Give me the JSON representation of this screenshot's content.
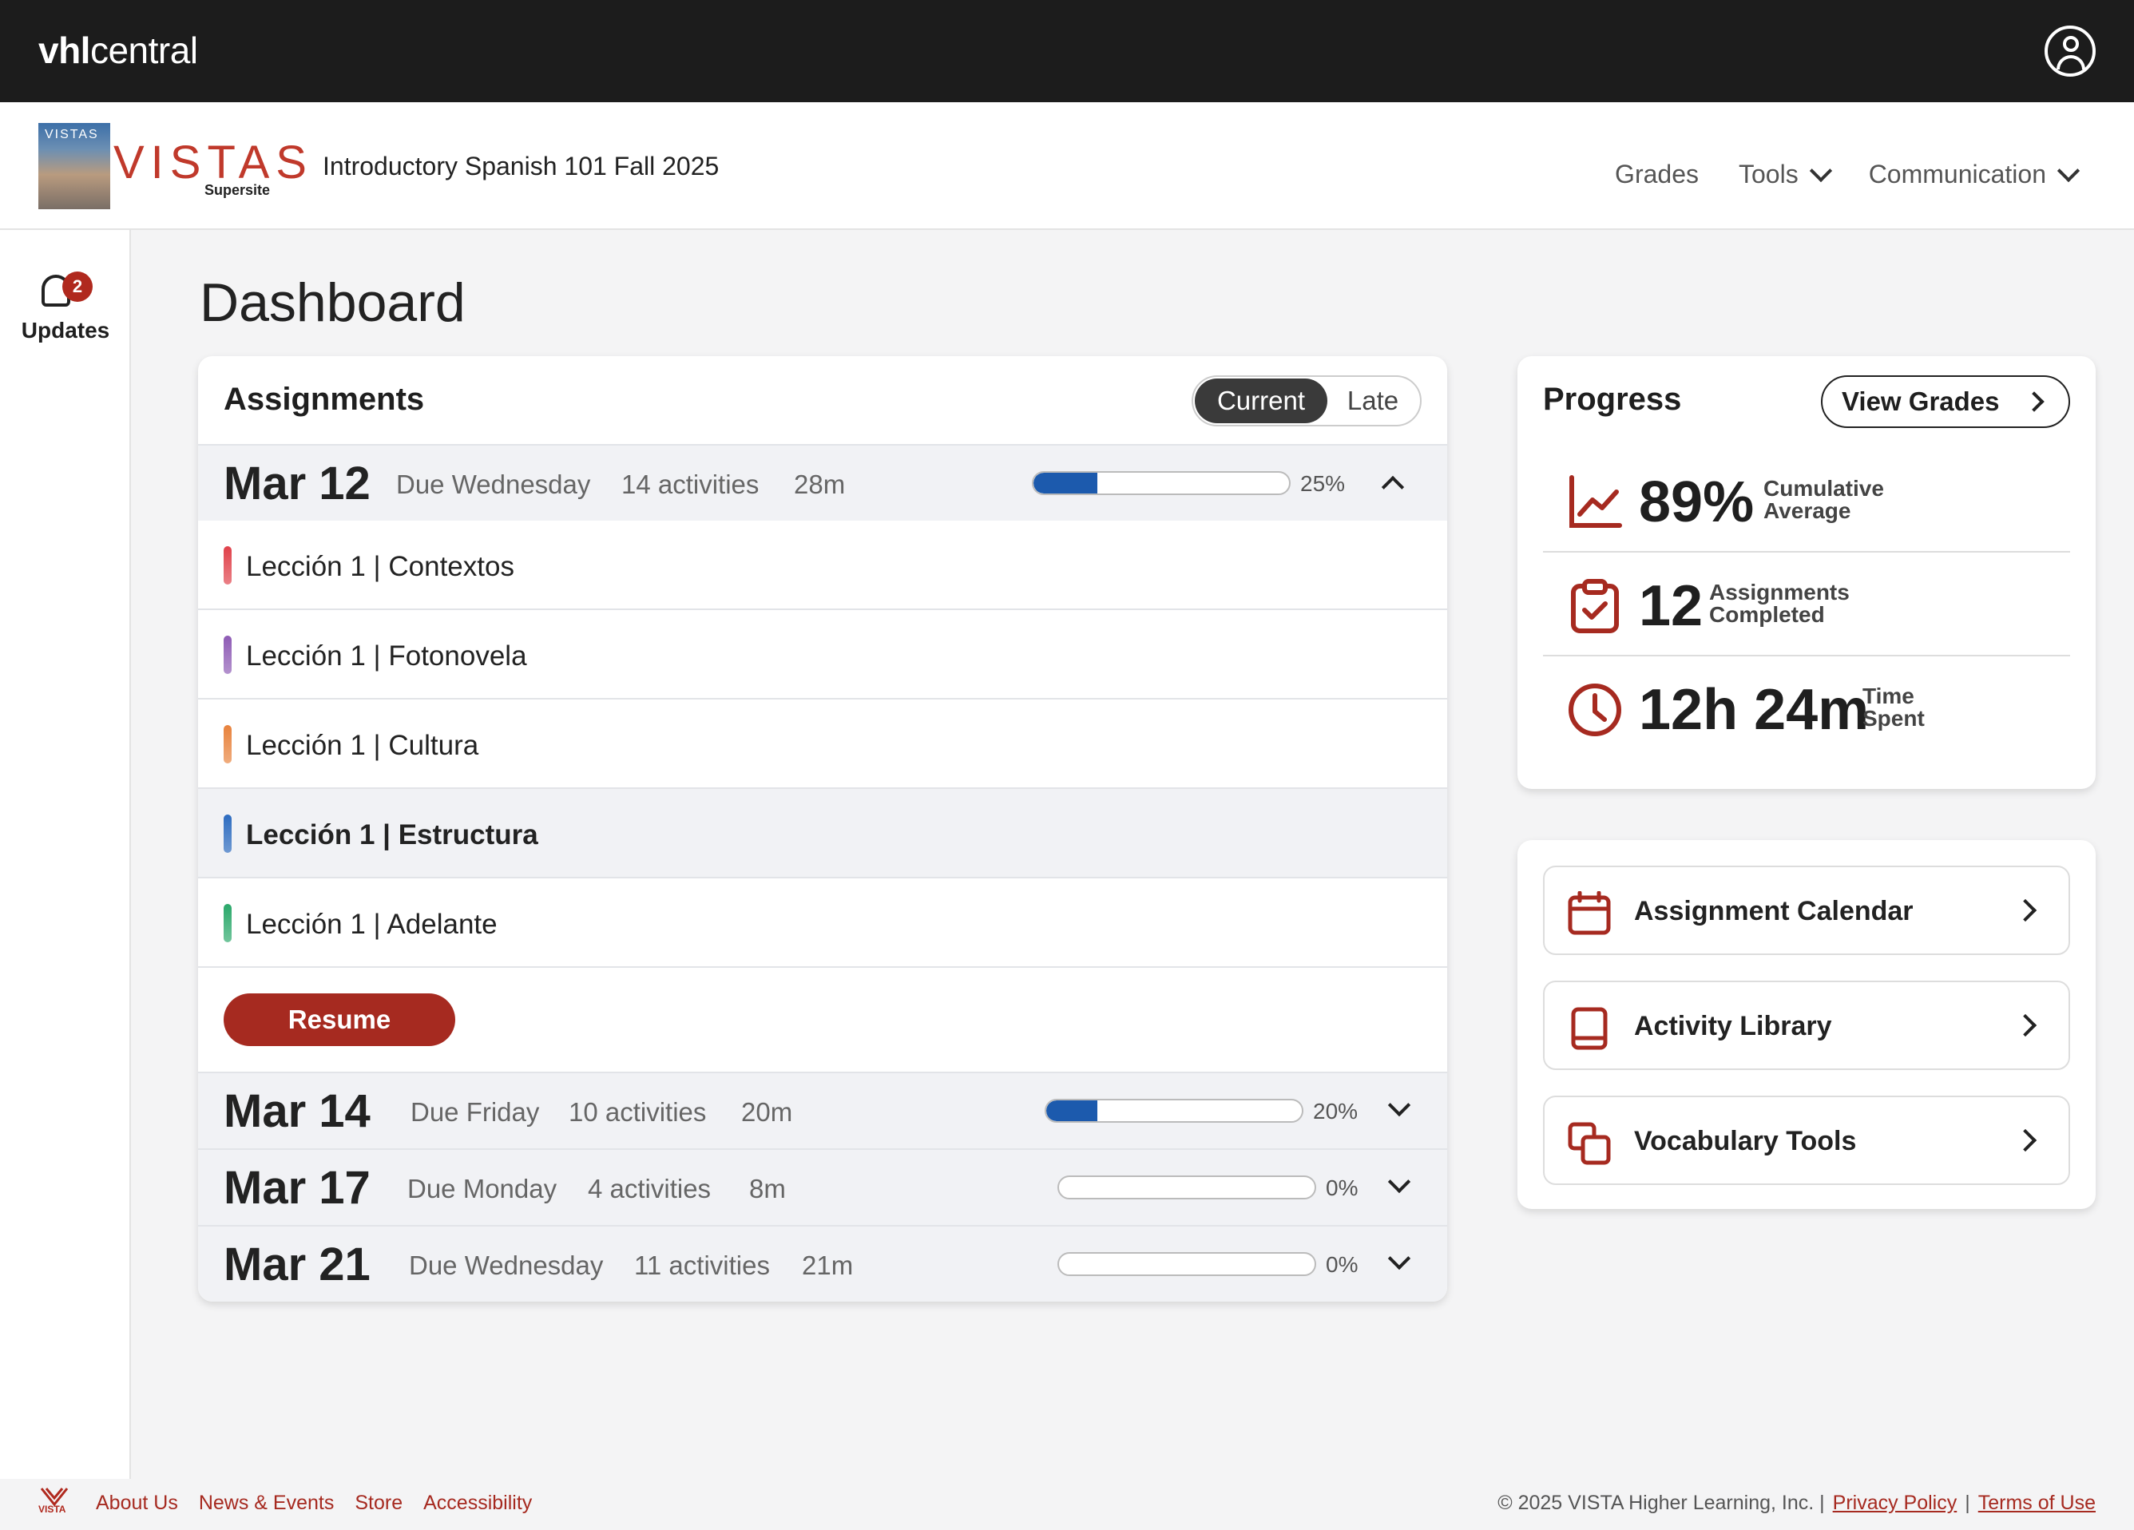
{
  "brand": {
    "bold": "vhl",
    "rest": "central"
  },
  "course": {
    "cover_text": "VISTAS",
    "logo_word": "VISTAS",
    "supersite": "Supersite",
    "title": "Introductory Spanish 101 Fall 2025"
  },
  "topnav": {
    "grades": "Grades",
    "tools": "Tools",
    "communication": "Communication"
  },
  "sidebar": {
    "updates_label": "Updates",
    "updates_count": "2"
  },
  "page": {
    "title": "Dashboard"
  },
  "assignments": {
    "title": "Assignments",
    "toggle_current": "Current",
    "toggle_late": "Late",
    "resume_label": "Resume",
    "weeks": [
      {
        "date": "Mar 12",
        "due": "Due Wednesday",
        "activities": "14 activities",
        "time": "28m",
        "progress": 0.25,
        "pct": "25%",
        "expanded": true
      },
      {
        "date": "Mar 14",
        "due": "Due Friday",
        "activities": "10 activities",
        "time": "20m",
        "progress": 0.2,
        "pct": "20%",
        "expanded": false
      },
      {
        "date": "Mar 17",
        "due": "Due Monday",
        "activities": "4 activities",
        "time": "8m",
        "progress": 0,
        "pct": "0%",
        "expanded": false
      },
      {
        "date": "Mar 21",
        "due": "Due Wednesday",
        "activities": "11 activities",
        "time": "21m",
        "progress": 0,
        "pct": "0%",
        "expanded": false
      }
    ],
    "lessons": [
      {
        "label": "Lección 1 | Contextos",
        "color": "#e0414a"
      },
      {
        "label": "Lección 1 | Fotonovela",
        "color": "#8e5bb5"
      },
      {
        "label": "Lección 1 | Cultura",
        "color": "#e8823c"
      },
      {
        "label": "Lección 1 | Estructura",
        "color": "#2d6cc0"
      },
      {
        "label": "Lección 1 | Adelante",
        "color": "#2aa86a"
      }
    ]
  },
  "progress": {
    "title": "Progress",
    "view_grades": "View Grades",
    "average_value": "89%",
    "average_label_1": "Cumulative",
    "average_label_2": "Average",
    "completed_value": "12",
    "completed_label_1": "Assignments",
    "completed_label_2": "Completed",
    "time_value": "12h 24m",
    "time_label_1": "Time",
    "time_label_2": "Spent"
  },
  "quicklinks": {
    "calendar": "Assignment Calendar",
    "library": "Activity Library",
    "vocab": "Vocabulary Tools"
  },
  "footer": {
    "about": "About Us",
    "news": "News & Events",
    "store": "Store",
    "accessibility": "Accessibility",
    "copyright": "© 2025 VISTA Higher Learning, Inc. |",
    "privacy": "Privacy Policy",
    "sep": "|",
    "terms": "Terms of Use",
    "logo_text": "VISTA"
  },
  "colors": {
    "accent": "#a62a20",
    "progress_fill": "#1c5aad",
    "topbar": "#1c1c1c"
  }
}
